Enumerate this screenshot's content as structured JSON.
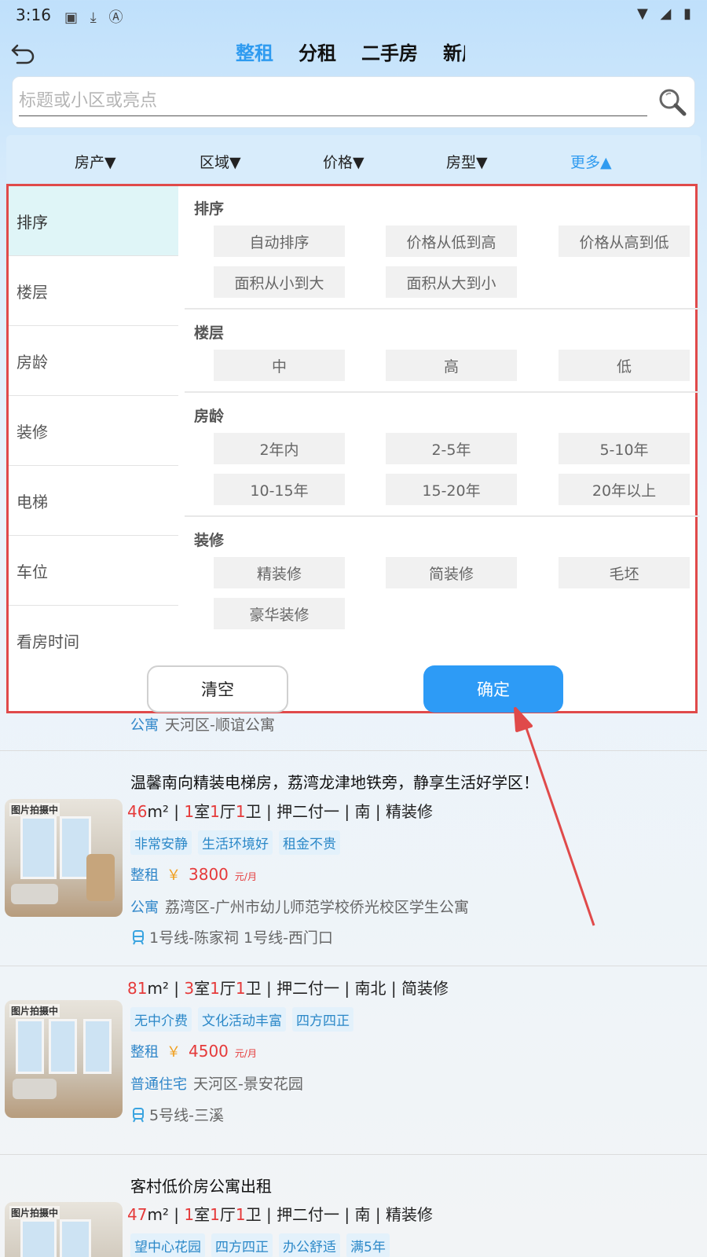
{
  "status": {
    "time": "3:16",
    "left_icons": [
      "image-icon",
      "download-icon",
      "a-icon"
    ],
    "right_icons": [
      "wifi-icon",
      "signal-icon",
      "battery-icon"
    ]
  },
  "tabs": [
    {
      "label": "整租",
      "active": true
    },
    {
      "label": "分租",
      "active": false
    },
    {
      "label": "二手房",
      "active": false
    },
    {
      "label": "新房",
      "active": false
    }
  ],
  "search": {
    "placeholder": "标题或小区或亮点"
  },
  "filters": [
    {
      "label": "房产▼"
    },
    {
      "label": "区域▼"
    },
    {
      "label": "价格▼"
    },
    {
      "label": "房型▼"
    },
    {
      "label": "更多▲",
      "active": true
    }
  ],
  "panel": {
    "menu": [
      "排序",
      "楼层",
      "房龄",
      "装修",
      "电梯",
      "车位",
      "看房时间"
    ],
    "sections": [
      {
        "title": "排序",
        "options": [
          "自动排序",
          "价格从低到高",
          "价格从高到低",
          "面积从小到大",
          "面积从大到小"
        ]
      },
      {
        "title": "楼层",
        "options": [
          "中",
          "高",
          "低"
        ]
      },
      {
        "title": "房龄",
        "options": [
          "2年内",
          "2-5年",
          "5-10年",
          "10-15年",
          "15-20年",
          "20年以上"
        ]
      },
      {
        "title": "装修",
        "options": [
          "精装修",
          "简装修",
          "毛坯",
          "豪华装修"
        ]
      }
    ],
    "clear_label": "清空",
    "confirm_label": "确定"
  },
  "partial_listing": {
    "type": "公寓",
    "address": "天河区-顺谊公寓"
  },
  "listings": [
    {
      "title": "温馨南向精装电梯房，荔湾龙津地铁旁，静享生活好学区！",
      "area": "46",
      "rooms": "1",
      "halls": "1",
      "baths": "1",
      "payment": "押二付一",
      "orientation": "南",
      "decoration": "精装修",
      "tags": [
        "非常安静",
        "生活环境好",
        "租金不贵"
      ],
      "rent_type": "整租",
      "currency": "￥",
      "price": "3800",
      "unit": "元/月",
      "prop_type": "公寓",
      "address": "荔湾区-广州市幼儿师范学校侨光校区学生公寓",
      "metro": "1号线-陈家祠 1号线-西门口",
      "photo_label": "图片拍摄中"
    },
    {
      "title": "",
      "area": "81",
      "rooms": "3",
      "halls": "1",
      "baths": "1",
      "payment": "押二付一",
      "orientation": "南北",
      "decoration": "简装修",
      "tags": [
        "无中介费",
        "文化活动丰富",
        "四方四正"
      ],
      "rent_type": "整租",
      "currency": "￥",
      "price": "4500",
      "unit": "元/月",
      "prop_type": "普通住宅",
      "address": "天河区-景安花园",
      "metro": "5号线-三溪",
      "photo_label": "图片拍摄中"
    },
    {
      "title": "客村低价房公寓出租",
      "area": "47",
      "rooms": "1",
      "halls": "1",
      "baths": "1",
      "payment": "押二付一",
      "orientation": "南",
      "decoration": "精装修",
      "tags": [
        "望中心花园",
        "四方四正",
        "办公舒适",
        "满5年"
      ],
      "photo_label": "图片拍摄中"
    }
  ],
  "colors": {
    "accent": "#2f9bf0",
    "annotation": "#e04a4a",
    "price": "#e53a3a"
  }
}
